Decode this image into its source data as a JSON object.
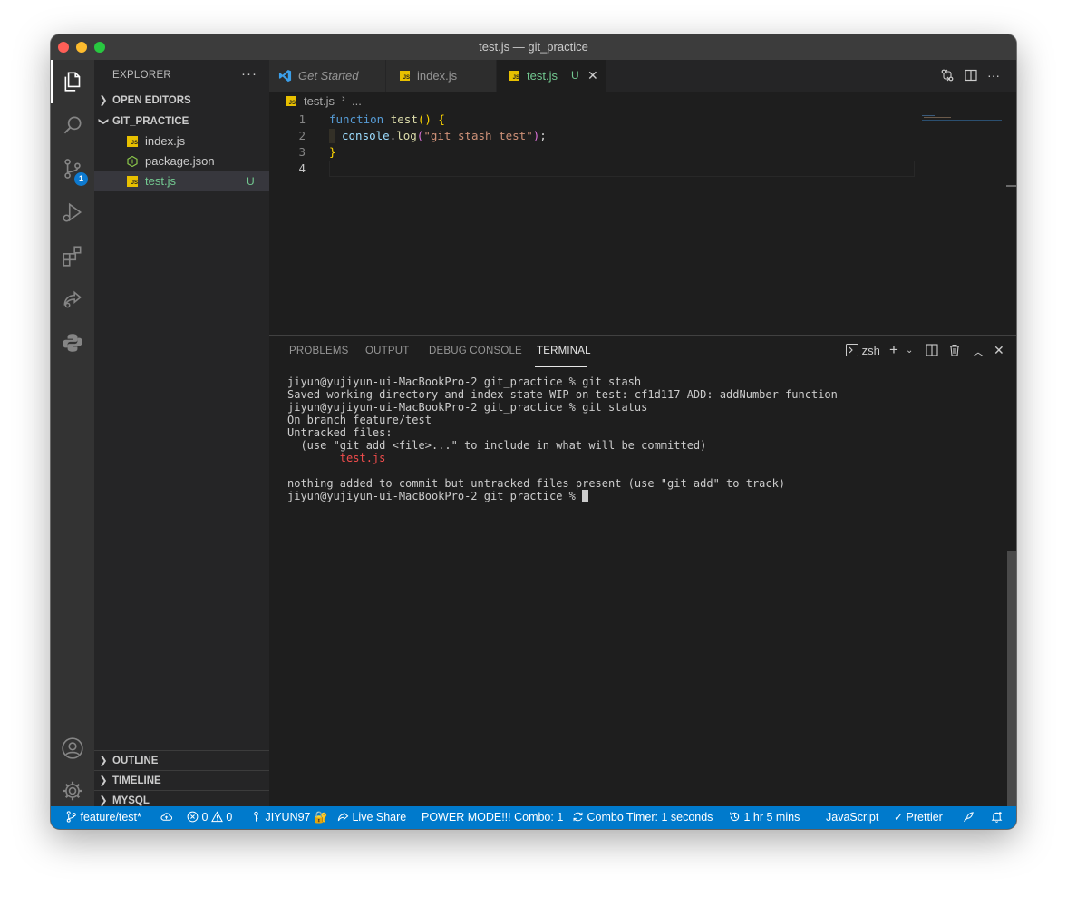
{
  "window": {
    "title": "test.js — git_practice"
  },
  "activity_bar": {
    "scm_badge": "1"
  },
  "sidebar": {
    "title": "EXPLORER",
    "more": "···",
    "open_editors": "OPEN EDITORS",
    "folder": "GIT_PRACTICE",
    "files": [
      {
        "name": "index.js",
        "status": ""
      },
      {
        "name": "package.json",
        "status": ""
      },
      {
        "name": "test.js",
        "status": "U"
      }
    ],
    "outline": "OUTLINE",
    "timeline": "TIMELINE",
    "mysql": "MYSQL"
  },
  "tabs": [
    {
      "label": "Get Started"
    },
    {
      "label": "index.js"
    },
    {
      "label": "test.js",
      "status": "U"
    }
  ],
  "breadcrumb": {
    "file": "test.js",
    "rest": "..."
  },
  "editor": {
    "line_numbers": [
      "1",
      "2",
      "3",
      "4"
    ],
    "lines": {
      "l1_kw": "function",
      "l1_fn": "test",
      "l1_br": "() {",
      "l2_var": "console",
      "l2_dot": ".",
      "l2_fn": "log",
      "l2_br1": "(",
      "l2_str": "\"git stash test\"",
      "l2_br2": ")",
      "l2_end": ";",
      "l3_br": "}"
    }
  },
  "panel": {
    "tabs": [
      "PROBLEMS",
      "OUTPUT",
      "DEBUG CONSOLE",
      "TERMINAL"
    ],
    "shell": "zsh",
    "terminal": [
      "jiyun@yujiyun-ui-MacBookPro-2 git_practice % git stash",
      "Saved working directory and index state WIP on test: cf1d117 ADD: addNumber function",
      "jiyun@yujiyun-ui-MacBookPro-2 git_practice % git status",
      "On branch feature/test",
      "Untracked files:",
      "  (use \"git add <file>...\" to include in what will be committed)",
      "        test.js",
      "",
      "nothing added to commit but untracked files present (use \"git add\" to track)",
      "jiyun@yujiyun-ui-MacBookPro-2 git_practice % "
    ]
  },
  "status_bar": {
    "branch": "feature/test*",
    "errors": "0",
    "warnings": "0",
    "user": "JIYUN97 🔐",
    "live_share": "Live Share",
    "power_mode": "POWER MODE!!! Combo: 1",
    "combo_timer": "Combo Timer: 1 seconds",
    "time": "1 hr 5 mins",
    "language": "JavaScript",
    "formatter": "Prettier"
  },
  "colors": {
    "accent": "#007acc",
    "untracked": "#73c991",
    "js_icon": "#e8c000"
  }
}
